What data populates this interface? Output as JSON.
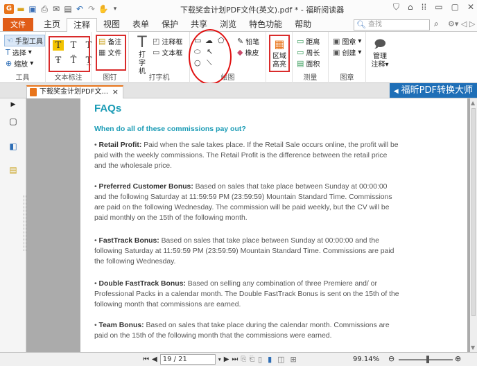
{
  "window": {
    "title": "下载奖金计划PDF文件(英文).pdf * - 福昕阅读器"
  },
  "menu": {
    "file": "文件",
    "tabs": [
      "主页",
      "注释",
      "视图",
      "表单",
      "保护",
      "共享",
      "浏览",
      "特色功能",
      "帮助"
    ],
    "active_tab": "注释",
    "search_placeholder": "查找"
  },
  "ribbon": {
    "tools": {
      "hand": "手型工具",
      "select": "选择",
      "zoom": "缩放",
      "label": "工具"
    },
    "text_markup": {
      "label": "文本标注"
    },
    "pin": {
      "note": "备注",
      "file": "文件",
      "label": "图钉"
    },
    "typewriter": {
      "typewriter": "打字机",
      "callout": "注释框",
      "textbox": "文本框",
      "label": "打字机"
    },
    "drawing": {
      "pencil": "铅笔",
      "eraser": "橡皮",
      "label": "绘图"
    },
    "highlight": {
      "area": "区域\n高亮"
    },
    "measure": {
      "distance": "距离",
      "perimeter": "周长",
      "area": "面积",
      "label": "测量"
    },
    "stamp": {
      "stamp": "图章",
      "create": "创建",
      "label": "图章"
    },
    "manage": {
      "manage": "管理\n注释"
    }
  },
  "tabbar": {
    "doc_tab": "下载奖金计划PDF文...",
    "promo": "福昕PDF转换大师"
  },
  "document": {
    "title": "FAQs",
    "question": "When do all of these commissions pay out?",
    "items": [
      {
        "label": "Retail Profit:",
        "text": " Paid when the sale takes place. If the Retail Sale occurs online, the profit will be paid with the weekly commissions. The Retail Profit is the difference between the retail price and the wholesale price."
      },
      {
        "label": "Preferred Customer Bonus:",
        "text": " Based on sales that take place between Sunday at 00:00:00 and the following Saturday at 11:59:59 PM (23:59:59) Mountain Standard Time. Commissions are paid on the following Wednesday. The commission will be paid weekly, but the CV will be paid monthly on the 15th of the following month."
      },
      {
        "label": "FastTrack Bonus:",
        "text": " Based on sales that take place between Sunday at 00:00:00 and the following Saturday at 11:59:59 PM (23:59:59) Mountain Standard Time. Commissions are paid the following Wednesday."
      },
      {
        "label": "Double FastTrack Bonus:",
        "text": " Based on selling any combination of three Premiere and/ or Professional Packs in a calendar month. The Double FastTrack Bonus is sent on the 15th of the following month that commissions are earned."
      },
      {
        "label": "Team Bonus:",
        "text": " Based on sales that take place during the calendar month. Commissions are paid on the 15th of the following month that the commissions were earned."
      }
    ]
  },
  "status": {
    "page": "19 / 21",
    "zoom": "99.14%"
  }
}
